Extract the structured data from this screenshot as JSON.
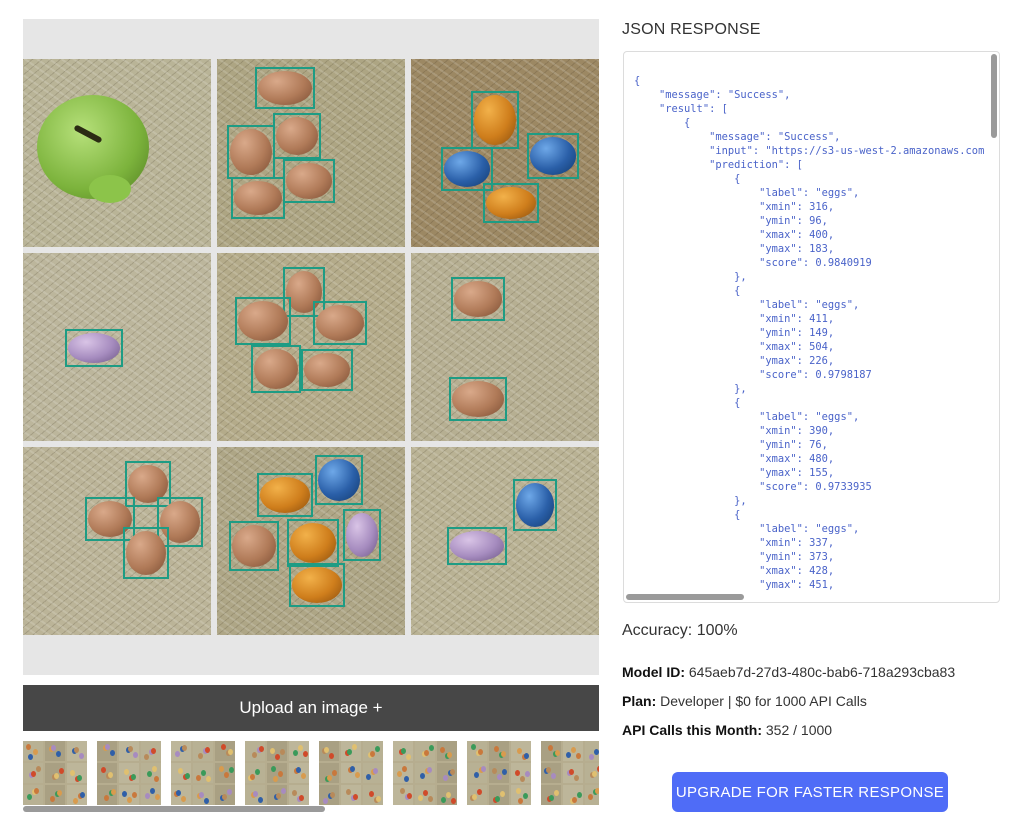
{
  "upload_button_label": "Upload an image +",
  "json_panel": {
    "title": "JSON RESPONSE",
    "content": "{\n    \"message\": \"Success\",\n    \"result\": [\n        {\n            \"message\": \"Success\",\n            \"input\": \"https://s3-us-west-2.amazonaws.com\n            \"prediction\": [\n                {\n                    \"label\": \"eggs\",\n                    \"xmin\": 316,\n                    \"ymin\": 96,\n                    \"xmax\": 400,\n                    \"ymax\": 183,\n                    \"score\": 0.9840919\n                },\n                {\n                    \"label\": \"eggs\",\n                    \"xmin\": 411,\n                    \"ymin\": 149,\n                    \"xmax\": 504,\n                    \"ymax\": 226,\n                    \"score\": 0.9798187\n                },\n                {\n                    \"label\": \"eggs\",\n                    \"xmin\": 390,\n                    \"ymin\": 76,\n                    \"xmax\": 480,\n                    \"ymax\": 155,\n                    \"score\": 0.9733935\n                },\n                {\n                    \"label\": \"eggs\",\n                    \"xmin\": 337,\n                    \"ymin\": 373,\n                    \"xmax\": 428,\n                    \"ymax\": 451,"
  },
  "accuracy": "Accuracy: 100%",
  "model": {
    "label": "Model ID:",
    "value": "645aeb7d-27d3-480c-bab6-718a293cba83"
  },
  "plan": {
    "label": "Plan:",
    "value": "Developer | $0 for 1000 API Calls"
  },
  "api_calls": {
    "label": "API Calls this Month:",
    "value": "352 / 1000"
  },
  "upgrade_button_label": "UPGRADE FOR FASTER RESPONSE",
  "colors": {
    "box": "#1e9c84",
    "upgrade": "#4f6cf7",
    "upload": "#474747",
    "json_text": "#4a63c9"
  }
}
